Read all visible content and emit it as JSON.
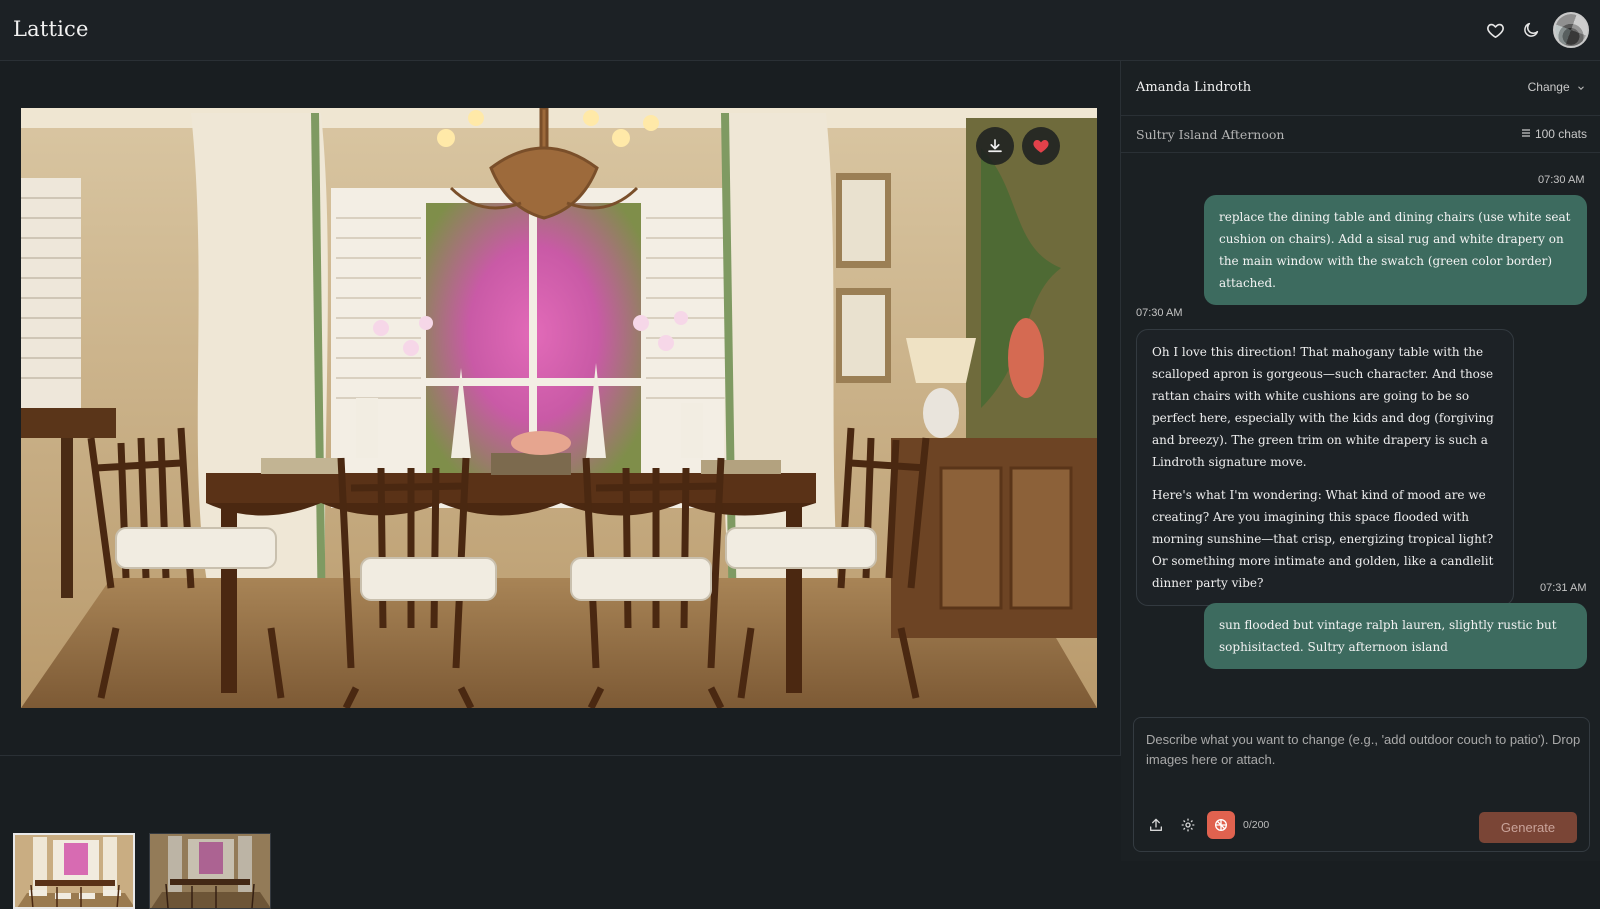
{
  "app": {
    "brand": "Lattice"
  },
  "header": {
    "icons": [
      "heart-icon",
      "moon-icon",
      "user-avatar"
    ]
  },
  "image_actions": {
    "icons": [
      "download-icon",
      "heart-filled-icon"
    ]
  },
  "thumbnails": {
    "count": 2,
    "selected_index": 0
  },
  "panel": {
    "designer_name": "Amanda Lindroth",
    "change_label": "Change",
    "chat_title": "Sultry Island Afternoon",
    "chats_count": "100 chats"
  },
  "messages": [
    {
      "role": "user",
      "time": "07:30 AM",
      "text": "replace the dining table and dining chairs (use white seat cushion on chairs). Add a sisal rug and white drapery on the main window with the swatch (green color border) attached."
    },
    {
      "role": "assistant",
      "time": "07:30 AM",
      "paragraphs": [
        "Oh I love this direction! That mahogany table with the scalloped apron is gorgeous—such character. And those rattan chairs with white cushions are going to be so perfect here, especially with the kids and dog (forgiving and breezy). The green trim on white drapery is such a Lindroth signature move.",
        "Here's what I'm wondering: What kind of mood are we creating? Are you imagining this space flooded with morning sunshine—that crisp, energizing tropical light? Or something more intimate and golden, like a candlelit dinner party vibe?"
      ]
    },
    {
      "role": "user",
      "time": "07:31 AM",
      "text": "sun flooded but vintage ralph lauren, slightly rustic but sophisitacted. Sultry afternoon island"
    }
  ],
  "composer": {
    "placeholder": "Describe what you want to change (e.g., 'add outdoor couch to patio'). Drop images here or attach.",
    "counter": "0/200",
    "generate_label": "Generate"
  },
  "colors": {
    "user_bubble": "#3d6b5f",
    "generate_bg": "#7a4536",
    "heart_accent": "#e2414a",
    "ai_icon_bg": "#e0624f"
  }
}
